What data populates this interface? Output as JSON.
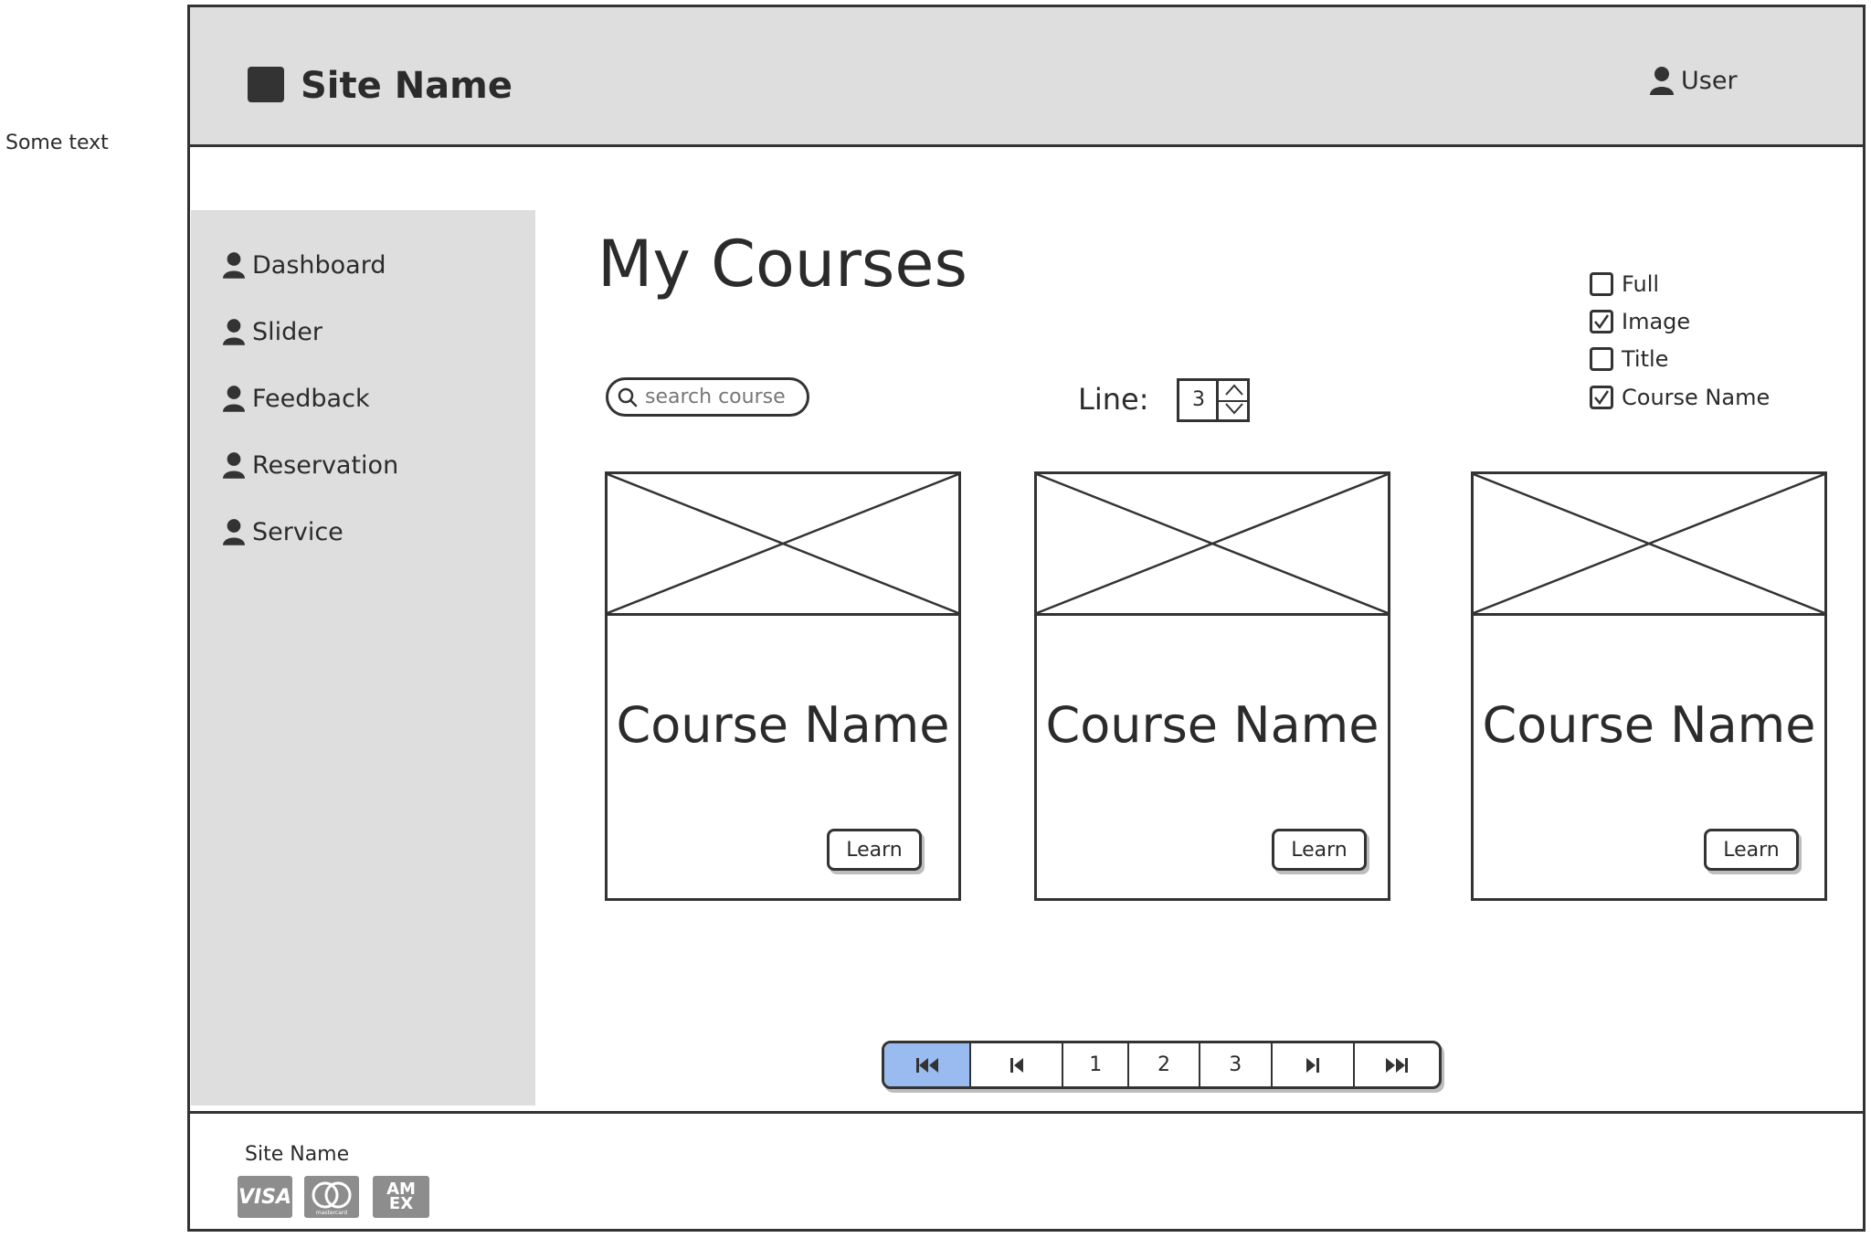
{
  "side_note": "Some text",
  "header": {
    "site_name": "Site Name",
    "user_label": "User"
  },
  "sidebar": {
    "items": [
      {
        "label": "Dashboard"
      },
      {
        "label": "Slider"
      },
      {
        "label": "Feedback"
      },
      {
        "label": "Reservation"
      },
      {
        "label": "Service"
      }
    ]
  },
  "main": {
    "title": "My Courses",
    "search": {
      "placeholder": "search course",
      "value": ""
    },
    "line": {
      "label": "Line:",
      "value": "3"
    },
    "options": [
      {
        "label": "Full",
        "checked": false
      },
      {
        "label": "Image",
        "checked": true
      },
      {
        "label": "Title",
        "checked": false
      },
      {
        "label": "Course Name",
        "checked": true
      }
    ],
    "cards": [
      {
        "name": "Course Name",
        "button": "Learn"
      },
      {
        "name": "Course Name",
        "button": "Learn"
      },
      {
        "name": "Course Name",
        "button": "Learn"
      }
    ],
    "pagination": {
      "pages": [
        "1",
        "2",
        "3"
      ],
      "active": "first"
    }
  },
  "footer": {
    "site_name": "Site Name",
    "payment_icons": [
      "visa-icon",
      "mastercard-icon",
      "amex-icon"
    ],
    "visa_text": "VISA",
    "mastercard_text": "mastercard",
    "amex_text_1": "AM",
    "amex_text_2": "EX"
  },
  "colors": {
    "header_bg": "#dedede",
    "sidebar_bg": "#dedede",
    "pager_active": "#99bbef",
    "ink": "#333333"
  }
}
